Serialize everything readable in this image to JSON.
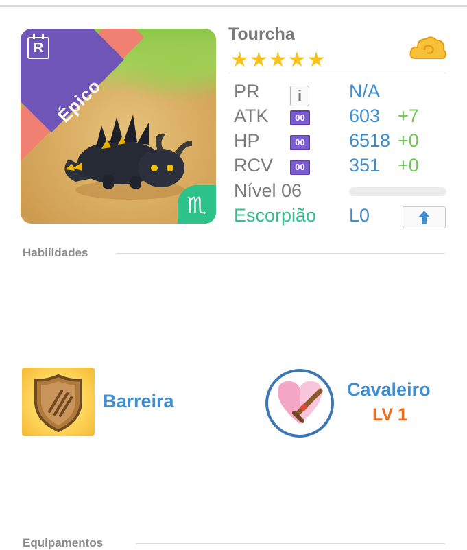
{
  "monster": {
    "name": "Tourcha",
    "stars": "★★★★★",
    "rarity_label": "Épico",
    "rarity_badge": "R",
    "zodiac_symbol": "♏",
    "currency_icon": "cloud-coin-icon"
  },
  "stats": [
    {
      "label": "PR",
      "badge": "i",
      "value": "N/A",
      "bonus": ""
    },
    {
      "label": "ATK",
      "badge": "00",
      "value": "603",
      "bonus": "+7"
    },
    {
      "label": "HP",
      "badge": "00",
      "value": "6518",
      "bonus": "+0"
    },
    {
      "label": "RCV",
      "badge": "00",
      "value": "351",
      "bonus": "+0"
    }
  ],
  "level": {
    "label": "Nível 06",
    "progress": 0
  },
  "zodiac": {
    "name": "Escorpião",
    "rank": "L0"
  },
  "sections": {
    "skills": "Habilidades",
    "equipment": "Equipamentos"
  },
  "skills": {
    "active": {
      "name": "Barreira",
      "icon": "shield-claw-icon"
    },
    "leader": {
      "name": "Cavaleiro",
      "level": "LV 1",
      "icon": "heart-sword-icon"
    }
  },
  "colors": {
    "accent_blue": "#3e8fd2",
    "bonus_green": "#6dc84f",
    "zodiac_green": "#2cc28a",
    "epic_purple": "#6f55b8",
    "epic_pink": "#f08072",
    "star_gold": "#f6c21b",
    "level_orange": "#f26a1b"
  }
}
